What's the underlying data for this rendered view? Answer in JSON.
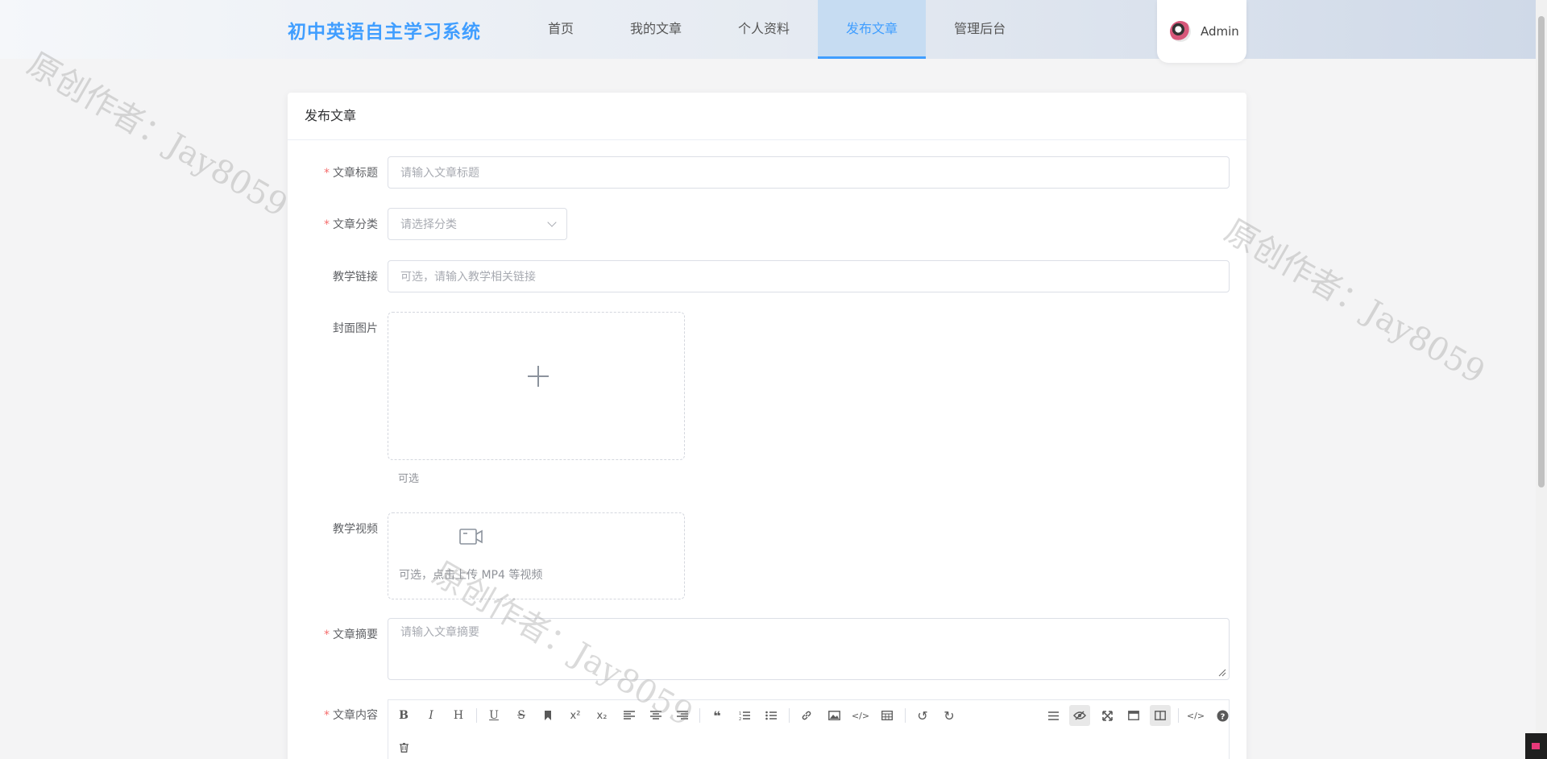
{
  "header": {
    "logo": "初中英语自主学习系统",
    "nav": [
      {
        "label": "首页"
      },
      {
        "label": "我的文章"
      },
      {
        "label": "个人资料"
      },
      {
        "label": "发布文章"
      },
      {
        "label": "管理后台"
      }
    ],
    "active_nav": "发布文章",
    "user_name": "Admin"
  },
  "card": {
    "title": "发布文章"
  },
  "form": {
    "title_label": "文章标题",
    "title_placeholder": "请输入文章标题",
    "category_label": "文章分类",
    "category_placeholder": "请选择分类",
    "link_label": "教学链接",
    "link_placeholder": "可选，请输入教学相关链接",
    "cover_label": "封面图片",
    "cover_hint": "可选",
    "video_label": "教学视频",
    "video_hint": "可选，点击上传 MP4 等视频",
    "summary_label": "文章摘要",
    "summary_placeholder": "请输入文章摘要",
    "content_label": "文章内容"
  },
  "editor_toolbar": {
    "row1_left": [
      "bold-icon",
      "italic-icon",
      "heading-icon",
      "underline-icon",
      "strikethrough-icon",
      "bookmark-icon",
      "superscript-icon",
      "subscript-icon",
      "align-left-icon",
      "align-center-icon",
      "align-right-icon",
      "quote-icon",
      "ordered-list-icon",
      "unordered-list-icon",
      "link-icon",
      "image-icon",
      "code-icon",
      "table-icon",
      "undo-icon",
      "redo-icon"
    ],
    "row1_right": [
      "navigation-icon",
      "preview-icon",
      "fullscreen-icon",
      "window-icon",
      "split-view-icon",
      "html-code-icon",
      "help-icon"
    ],
    "row2": [
      "trash-icon"
    ]
  },
  "watermark_text": "原创作者：Jay8059",
  "colors": {
    "accent": "#409eff",
    "required": "#f56c6c",
    "nav_active_bg": "#c6dcf2"
  }
}
